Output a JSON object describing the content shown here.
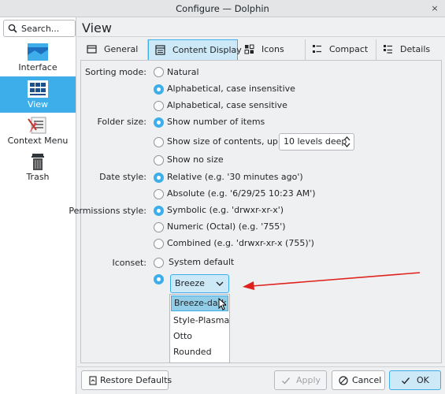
{
  "window": {
    "title": "Configure — Dolphin",
    "close_glyph": "×"
  },
  "sidebar": {
    "search_placeholder": "Search...",
    "items": [
      {
        "label": "Interface",
        "icon": "interface-icon"
      },
      {
        "label": "View",
        "icon": "view-icon",
        "selected": true
      },
      {
        "label": "Context Menu",
        "icon": "context-menu-icon"
      },
      {
        "label": "Trash",
        "icon": "trash-icon"
      }
    ]
  },
  "page": {
    "title": "View"
  },
  "tabs": [
    {
      "label": "General",
      "icon": "general-icon"
    },
    {
      "label": "Content Display",
      "icon": "content-display-icon",
      "active": true
    },
    {
      "label": "Icons",
      "icon": "icons-icon"
    },
    {
      "label": "Compact",
      "icon": "compact-icon"
    },
    {
      "label": "Details",
      "icon": "details-icon"
    }
  ],
  "content": {
    "sorting": {
      "label": "Sorting mode:",
      "options": [
        "Natural",
        "Alphabetical, case insensitive",
        "Alphabetical, case sensitive"
      ],
      "selected": 1
    },
    "folder_size": {
      "label": "Folder size:",
      "options": [
        "Show number of items",
        "Show size of contents, up to",
        "Show no size"
      ],
      "selected": 0,
      "levels_value": "10 levels deep"
    },
    "date_style": {
      "label": "Date style:",
      "options": [
        "Relative (e.g. '30 minutes ago')",
        "Absolute (e.g. '6/29/25 10:23 AM')"
      ],
      "selected": 0
    },
    "permissions_style": {
      "label": "Permissions style:",
      "options": [
        "Symbolic (e.g. 'drwxr-xr-x')",
        "Numeric (Octal) (e.g. '755')",
        "Combined (e.g. 'drwxr-xr-x (755)')"
      ],
      "selected": 0
    },
    "iconset": {
      "label": "Iconset:",
      "options": [
        "System default"
      ],
      "selected": 1,
      "combo_value": "Breeze",
      "dropdown_items": [
        "Breeze-dark",
        "Style-Plasma",
        "Otto",
        "Rounded"
      ],
      "hovered_item": 0
    }
  },
  "footer": {
    "restore_defaults": "Restore Defaults",
    "apply": "Apply",
    "cancel": "Cancel",
    "ok": "OK"
  },
  "colors": {
    "accent": "#3daee9",
    "selection": "#cde8f7",
    "annotation_arrow": "#e0201c"
  }
}
